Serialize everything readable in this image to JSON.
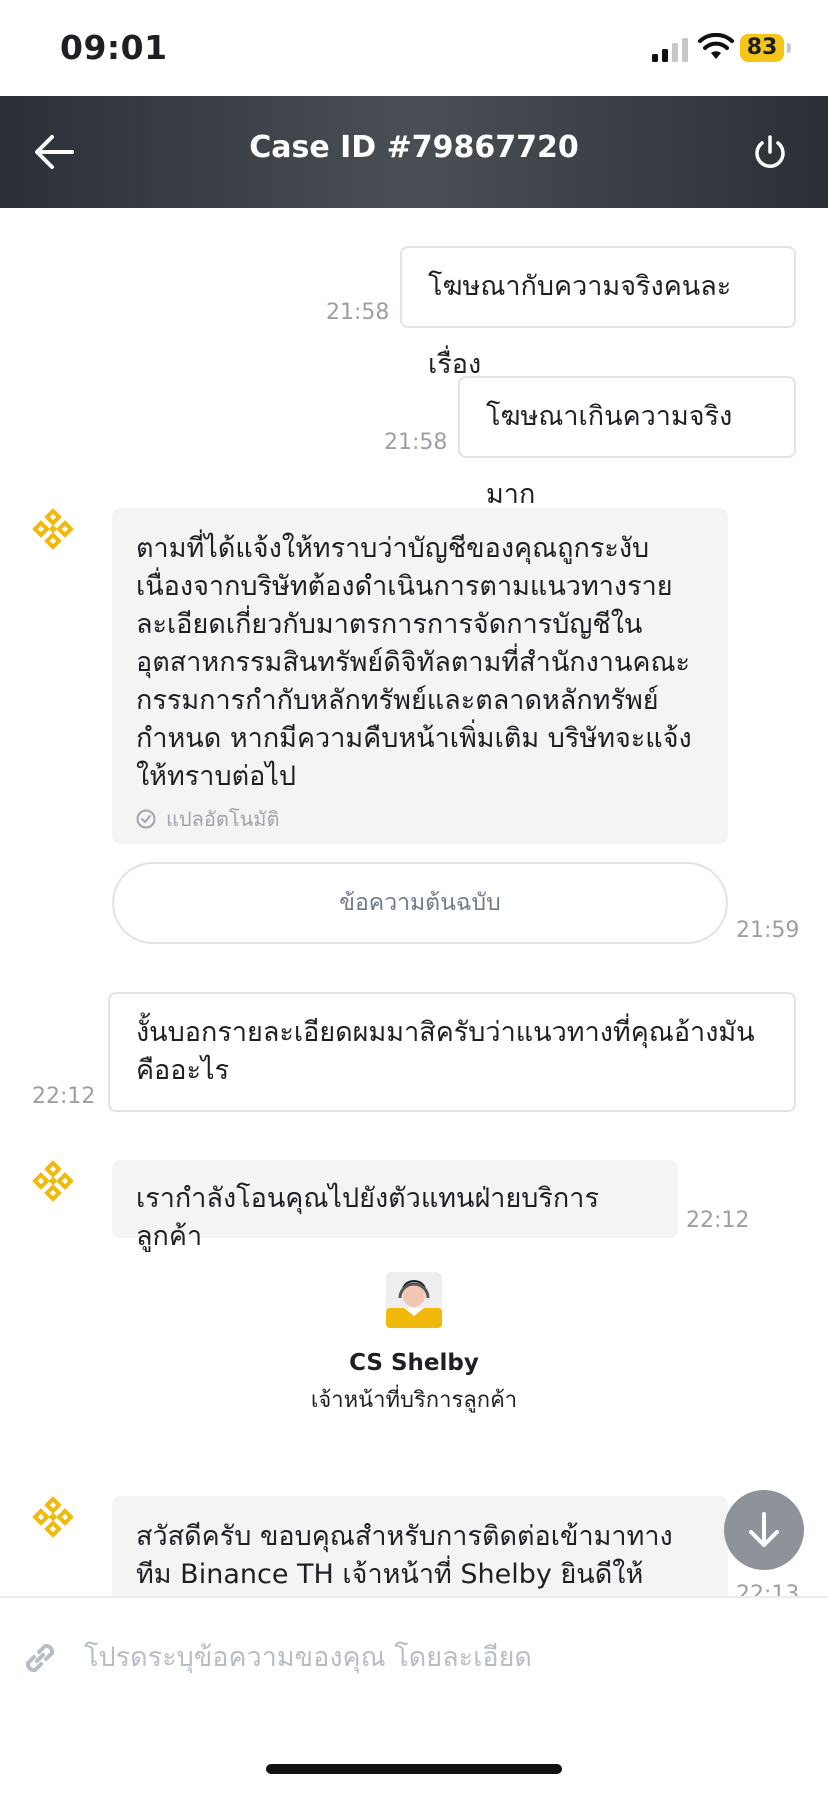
{
  "status_bar": {
    "time": "09:01",
    "battery": "83"
  },
  "header": {
    "title": "Case ID #79867720"
  },
  "messages": [
    {
      "text": "โฆษณากับความจริงคนละเรื่อง",
      "time": "21:58"
    },
    {
      "text": "โฆษณาเกินความจริงมาก",
      "time": "21:58"
    },
    {
      "text": "ตามที่ได้แจ้งให้ทราบว่าบัญชีของคุณถูกระงับ เนื่องจากบริษัทต้องดำเนินการตามแนวทางรายละเอียดเกี่ยวกับมาตรการการจัดการบัญชีในอุตสาหกรรมสินทรัพย์ดิจิทัลตามที่สำนักงานคณะกรรมการกำกับหลักทรัพย์และตลาดหลักทรัพย์กำหนด หากมีความคืบหน้าเพิ่มเติม บริษัทจะแจ้งให้ทราบต่อไป",
      "auto_translated": "แปลอัตโนมัติ",
      "original_button": "ข้อความต้นฉบับ",
      "time": "21:59"
    },
    {
      "text": "งั้นบอกรายละเอียดผมมาสิครับว่าแนวทางที่คุณอ้างมันคืออะไร",
      "time": "22:12"
    },
    {
      "text": "เรากำลังโอนคุณไปยังตัวแทนฝ่ายบริการลูกค้า",
      "time": "22:12"
    },
    {
      "text": "สวัสดีครับ ขอบคุณสำหรับการติดต่อเข้ามาทางทีม Binance TH เจ้าหน้าที่ Shelby ยินดีให้บริการครับ",
      "time": "22:13"
    }
  ],
  "agent": {
    "name": "CS Shelby",
    "role": "เจ้าหน้าที่บริการลูกค้า"
  },
  "composer": {
    "placeholder": "โปรดระบุข้อความของคุณ โดยละเอียด"
  },
  "colors": {
    "brand": "#F0B90B",
    "header_bg": "#2B2F36",
    "bubble_in": "#F4F4F5"
  }
}
